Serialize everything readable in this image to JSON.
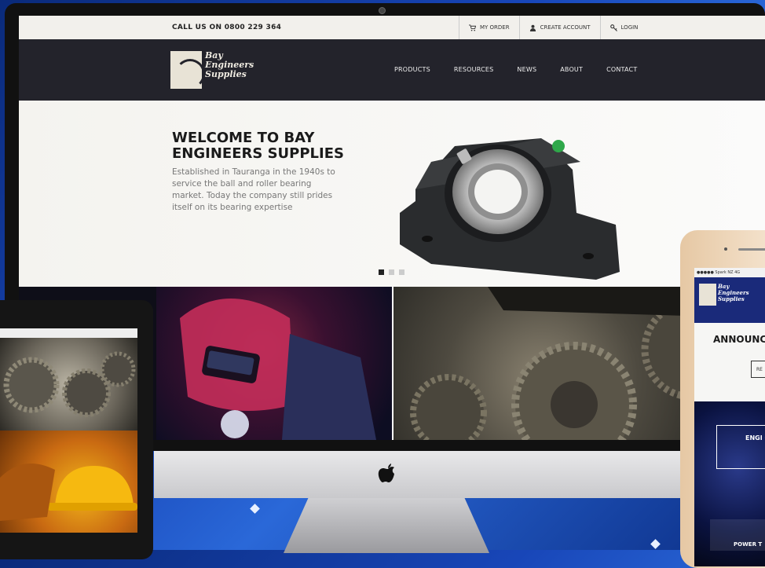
{
  "topbar": {
    "call_us": "CALL US ON 0800 229 364",
    "links": [
      {
        "label": "MY ORDER",
        "icon": "cart-icon"
      },
      {
        "label": "CREATE ACCOUNT",
        "icon": "user-icon"
      },
      {
        "label": "LOGIN",
        "icon": "key-icon"
      }
    ]
  },
  "logo": {
    "line1": "Bay",
    "line2": "Engineers",
    "line3": "Supplies"
  },
  "nav": [
    "PRODUCTS",
    "RESOURCES",
    "NEWS",
    "ABOUT",
    "CONTACT"
  ],
  "hero": {
    "title": "WELCOME TO BAY ENGINEERS SUPPLIES",
    "body": "Established in Tauranga in the 1940s to service the ball and roller bearing market. Today the company still prides itself on its bearing expertise",
    "slide_count": 3,
    "active_slide": 1
  },
  "phone": {
    "status": "●●●●● Spark NZ  4G",
    "announce": "ANNOUNC DISTRIB",
    "button": "RE",
    "box_text": "ENGI CONS",
    "box2_text": "POWER T"
  },
  "colors": {
    "header_bg": "#23232b",
    "topbar_bg": "#f2f0ec",
    "background": "#1846b8"
  }
}
